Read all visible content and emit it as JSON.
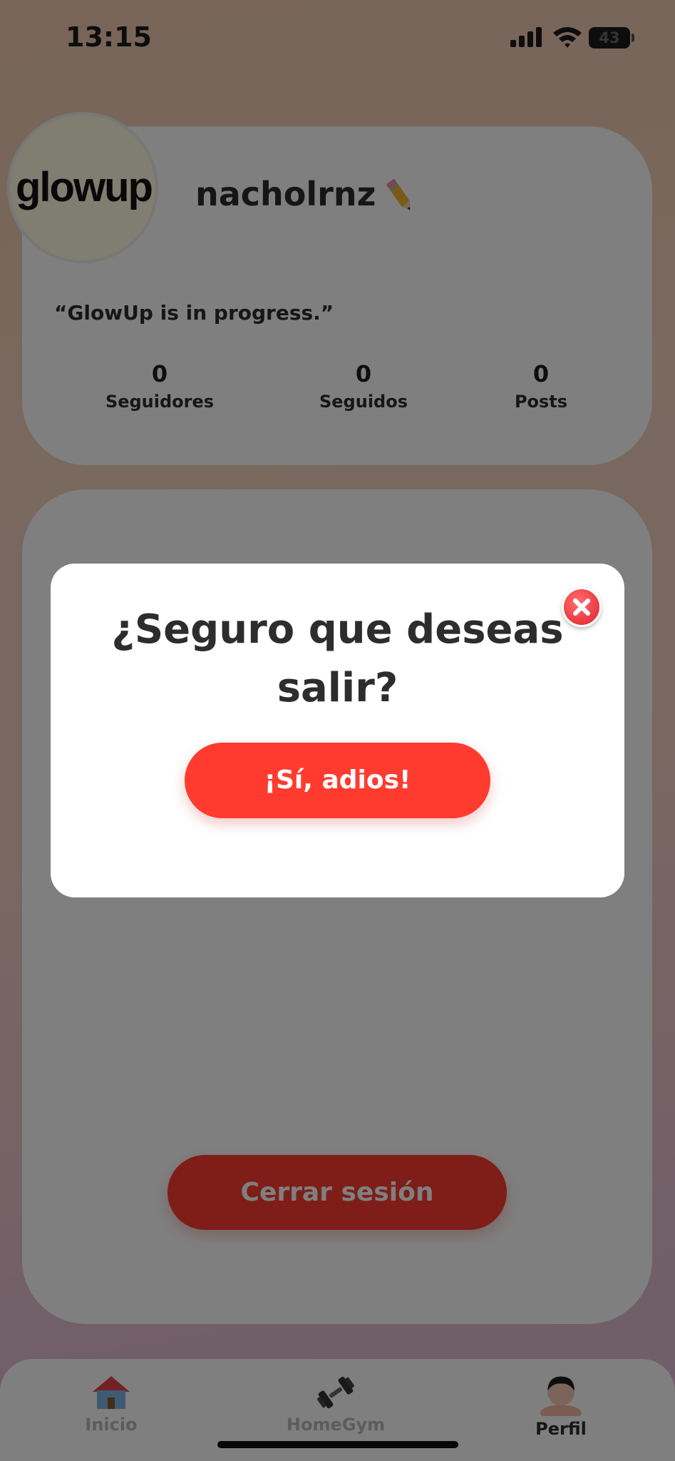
{
  "status_bar": {
    "time": "13:15",
    "battery": "43"
  },
  "profile": {
    "logo_text": "glowup",
    "username": "nacholrnz",
    "edit_icon": "pencil-icon",
    "bio": "“GlowUp is in progress.”",
    "stats": [
      {
        "value": "0",
        "label": "Seguidores"
      },
      {
        "value": "0",
        "label": "Seguidos"
      },
      {
        "value": "0",
        "label": "Posts"
      }
    ]
  },
  "logout_button": "Cerrar sesión",
  "tab_bar": {
    "tabs": [
      {
        "label": "Inicio",
        "icon": "house-icon",
        "active": false
      },
      {
        "label": "HomeGym",
        "icon": "dumbbell-icon",
        "active": false
      },
      {
        "label": "Perfil",
        "icon": "person-avatar-icon",
        "active": true
      }
    ]
  },
  "modal": {
    "title": "¿Seguro que deseas salir?",
    "confirm_label": "¡Sí, adios!",
    "close_icon": "close-circle-icon"
  },
  "colors": {
    "accent": "#ff3b30",
    "text": "#2d2d2d"
  }
}
